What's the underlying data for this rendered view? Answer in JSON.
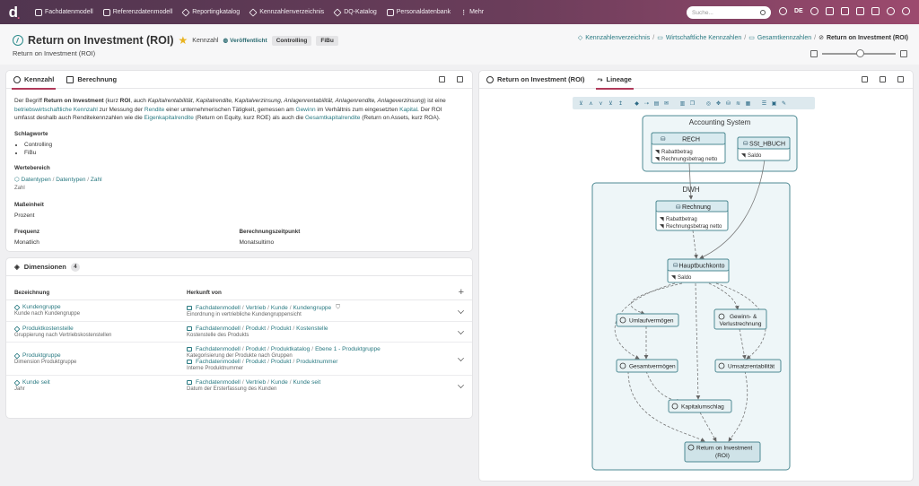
{
  "nav": {
    "logo": "d",
    "items": [
      {
        "label": "Fachdatenmodell",
        "icon": "database-icon"
      },
      {
        "label": "Referenzdatenmodell",
        "icon": "database-icon"
      },
      {
        "label": "Reportingkatalog",
        "icon": "diamond-icon"
      },
      {
        "label": "Kennzahlenverzeichnis",
        "icon": "diamond-icon"
      },
      {
        "label": "DQ-Katalog",
        "icon": "diamond-icon"
      },
      {
        "label": "Personaldatenbank",
        "icon": "database-icon"
      },
      {
        "label": "Mehr",
        "icon": "more-icon"
      }
    ],
    "search_placeholder": "Suche...",
    "language": "DE"
  },
  "header": {
    "title": "Return on Investment (ROI)",
    "type": "Kennzahl",
    "status": "Veröffentlicht",
    "tags": [
      "Controlling",
      "FiBu"
    ],
    "subtitle": "Return on Investment (ROI)",
    "breadcrumb": [
      "Kennzahlenverzeichnis",
      "Wirtschaftliche Kennzahlen",
      "Gesamtkennzahlen",
      "Return on Investment (ROI)"
    ],
    "zoom_level": 0.5
  },
  "left_panel": {
    "tabs": [
      "Kennzahl",
      "Berechnung"
    ],
    "description": {
      "p1": "Der Begriff ",
      "b1": "Return on Investment",
      "p2": " (kurz ",
      "b2": "ROI",
      "p3": ", auch ",
      "i1": "Kapitalrentabilität, Kapitalrendite, Kapitalverzinsung, Anlagenrentabilität, Anlagenrendite, Anlageverzinsung",
      "p4": ") ist eine ",
      "l1": "betriebswirtschaftliche Kennzahl",
      "p5": " zur Messung der ",
      "l2": "Rendite",
      "p6": " einer unternehmerischen Tätigkeit, gemessen am ",
      "l3": "Gewinn",
      "p7": " im Verhältnis zum eingesetzten ",
      "l4": "Kapital",
      "p8": ". Der ROI umfasst deshalb auch Renditekennzahlen wie die ",
      "l5": "Eigenkapitalrendite",
      "p9": " (Return on Equity, kurz ROE) als auch die ",
      "l6": "Gesamtkapitalrendite",
      "p10": " (Return on Assets, kurz ROA)."
    },
    "keywords_label": "Schlagworte",
    "keywords": [
      "Controlling",
      "FiBu"
    ],
    "value_range_label": "Wertebereich",
    "value_range_path": [
      "Datentypen",
      "Datentypen",
      "Zahl"
    ],
    "value_range_sub": "Zahl",
    "unit_label": "Maßeinheit",
    "unit": "Prozent",
    "frequency_label": "Frequenz",
    "frequency": "Monatlich",
    "calc_time_label": "Berechnungszeitpunkt",
    "calc_time": "Monatsultimo"
  },
  "dimensions": {
    "title": "Dimensionen",
    "count": "4",
    "col1": "Bezeichnung",
    "col2": "Herkunft von",
    "rows": [
      {
        "name": "Kundengruppe",
        "sub": "Kunde nach Kundengruppe",
        "origins": [
          {
            "path": [
              "Fachdatenmodell",
              "Vertrieb",
              "Kunde",
              "Kundengruppe"
            ],
            "desc": "Einordnung in vertriebliche Kundengruppensicht"
          }
        ]
      },
      {
        "name": "Produktkostenstelle",
        "sub": "Gruppierung nach Vertriebskostenstellen",
        "origins": [
          {
            "path": [
              "Fachdatenmodell",
              "Produkt",
              "Produkt",
              "Kostenstelle"
            ],
            "desc": "Kostenstelle des Produkts"
          }
        ]
      },
      {
        "name": "Produktgruppe",
        "sub": "Dimension Produktgruppe",
        "origins": [
          {
            "path": [
              "Fachdatenmodell",
              "Produkt",
              "Produktkatalog",
              "Ebene 1 - Produktgruppe"
            ],
            "desc": "Kategorisierung der Produkte nach Gruppen"
          },
          {
            "path": [
              "Fachdatenmodell",
              "Produkt",
              "Produkt",
              "Produktnummer"
            ],
            "desc": "Interne Produktnummer"
          }
        ]
      },
      {
        "name": "Kunde seit",
        "sub": "Jahr",
        "origins": [
          {
            "path": [
              "Fachdatenmodell",
              "Vertrieb",
              "Kunde",
              "Kunde seit"
            ],
            "desc": "Datum der Ersterfassung des Kunden"
          }
        ]
      }
    ]
  },
  "right_panel": {
    "tabs": [
      "Return on Investment (ROI)",
      "Lineage"
    ]
  },
  "lineage": {
    "groups": {
      "source": "Accounting System",
      "dwh": "DWH"
    },
    "nodes": {
      "rech": {
        "title": "RECH",
        "fields": [
          "Rabattbetrag",
          "Rechnungsbetrag netto"
        ]
      },
      "sst": {
        "title": "SSt_HBUCH",
        "fields": [
          "Saldo"
        ]
      },
      "rechnung": {
        "title": "Rechnung",
        "fields": [
          "Rabattbetrag",
          "Rechnungsbetrag netto"
        ]
      },
      "hauptbuch": {
        "title": "Hauptbuchkonto",
        "fields": [
          "Saldo"
        ]
      },
      "umlauf": {
        "title": "Umlaufvermögen"
      },
      "gewinn": {
        "title": "Gewinn- &",
        "title2": "Verlustrechnung"
      },
      "gesamt": {
        "title": "Gesamtvermögen"
      },
      "umsatz": {
        "title": "Umsatzrentabilität"
      },
      "kapital": {
        "title": "Kapitalumschlag"
      },
      "roi": {
        "title": "Return on Investment",
        "title2": "(ROI)"
      }
    }
  }
}
